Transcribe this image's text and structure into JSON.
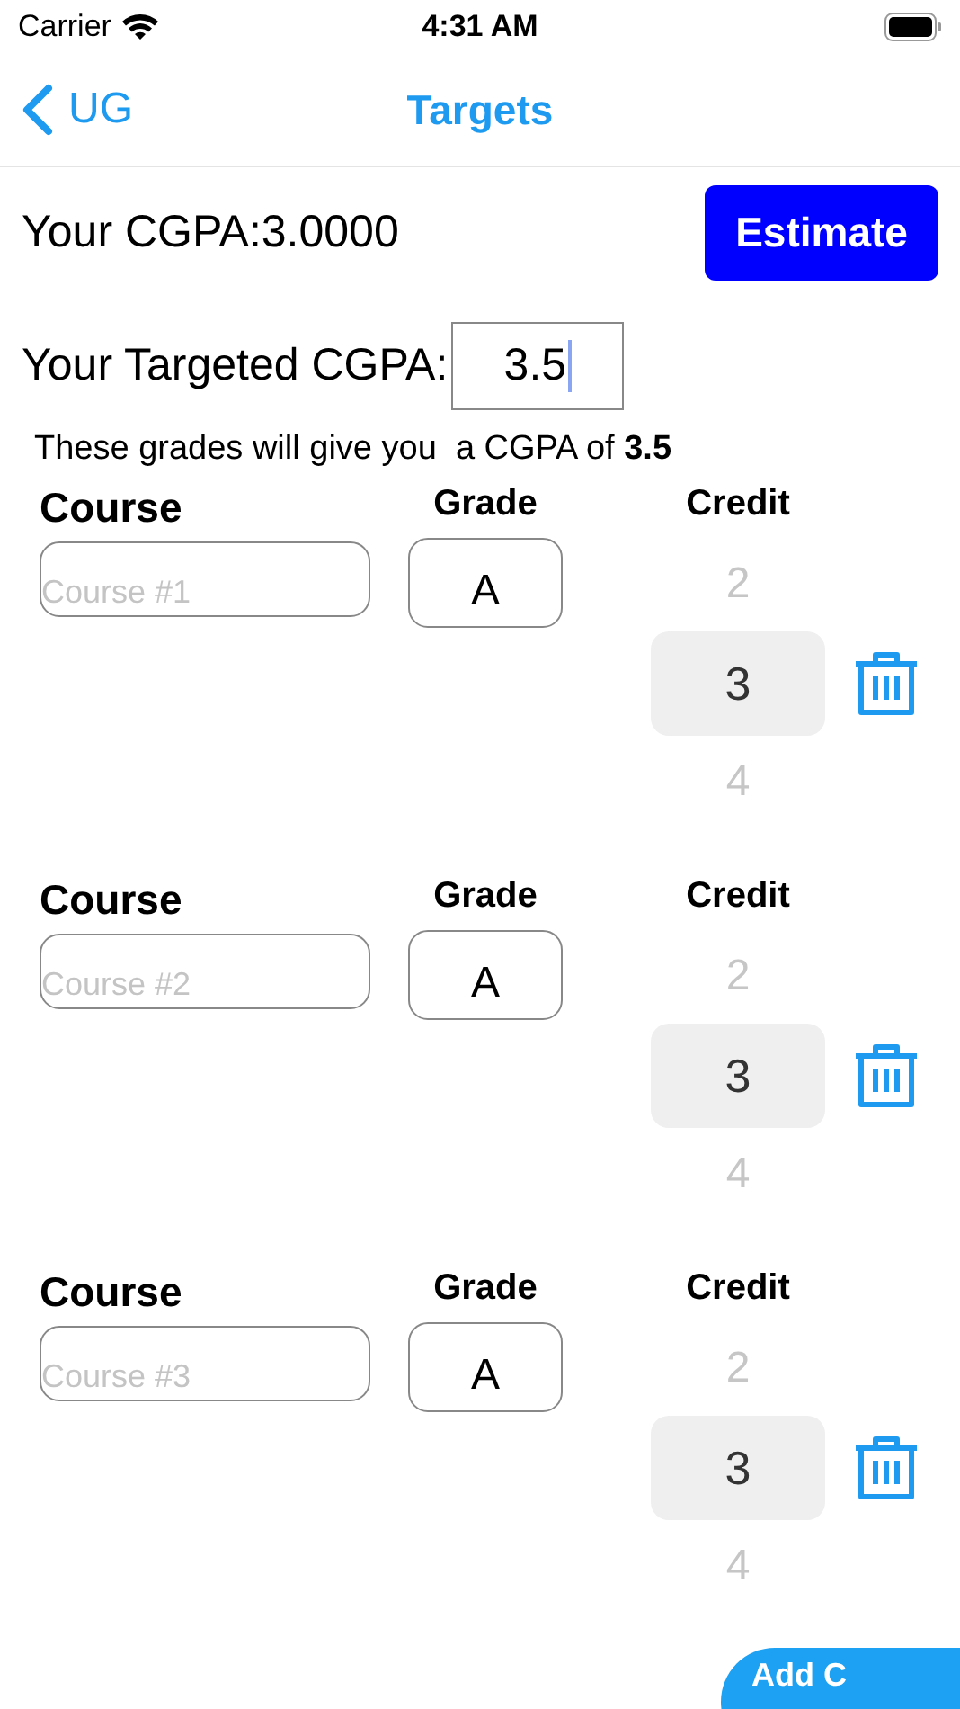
{
  "status_bar": {
    "carrier": "Carrier",
    "time": "4:31 AM"
  },
  "nav": {
    "back": "UG",
    "title": "Targets"
  },
  "current": {
    "label": "Your CGPA:3.0000",
    "button": "Estimate"
  },
  "target": {
    "label": "Your Targeted CGPA:",
    "value": "3.5",
    "focused": true
  },
  "summary": "These grades will give you  a CGPA of **3.5**",
  "courses": [
    {
      "course_header": "Course",
      "course_placeholder": "Course #1",
      "grade_header": "Grade",
      "grade": "A",
      "credit_header": "Credit",
      "credit_options": [
        {
          "label": "2",
          "selected": false
        },
        {
          "label": "3",
          "selected": true
        },
        {
          "label": "4",
          "selected": false
        }
      ]
    },
    {
      "course_header": "Course",
      "course_placeholder": "Course #2",
      "grade_header": "Grade",
      "grade": "A",
      "credit_header": "Credit",
      "credit_options": [
        {
          "label": "2",
          "selected": false
        },
        {
          "label": "3",
          "selected": true
        },
        {
          "label": "4",
          "selected": false
        }
      ]
    },
    {
      "course_header": "Course",
      "course_placeholder": "Course #3",
      "grade_header": "Grade",
      "grade": "A",
      "credit_header": "Credit",
      "credit_options": [
        {
          "label": "2",
          "selected": false
        },
        {
          "label": "3",
          "selected": true
        },
        {
          "label": "4",
          "selected": false
        }
      ]
    }
  ],
  "add_button": "Add C"
}
